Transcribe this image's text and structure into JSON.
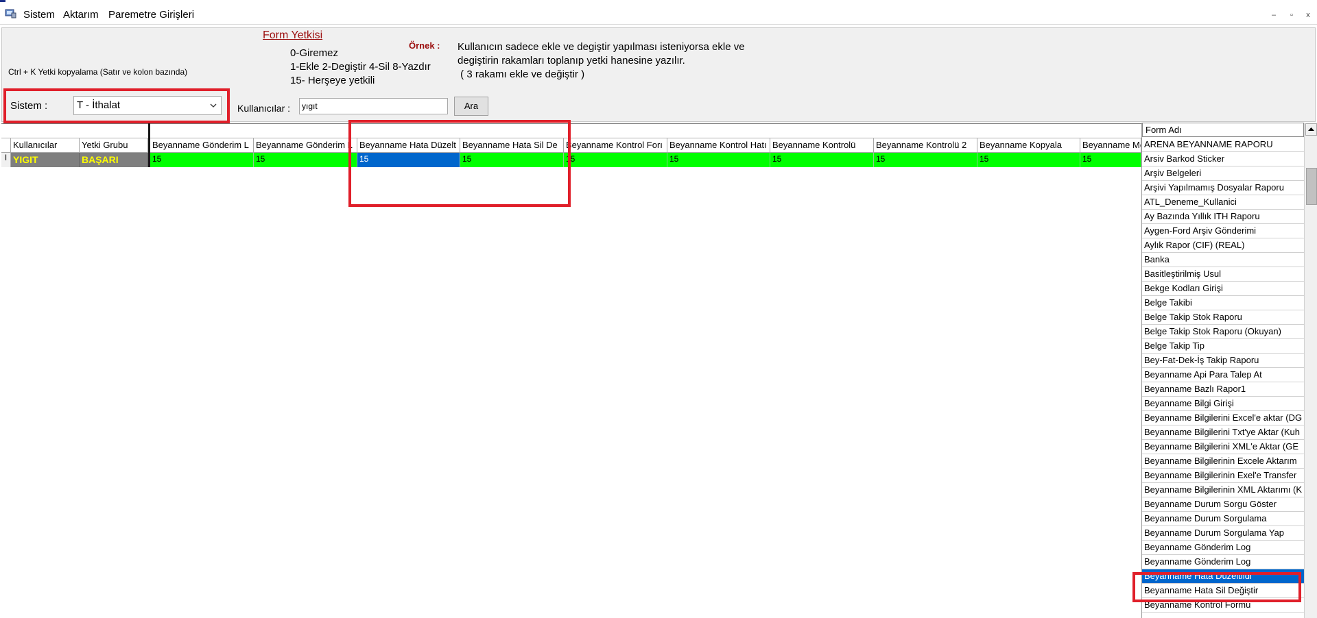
{
  "menu": {
    "items": [
      "Sistem",
      "Aktarım",
      "Paremetre Girişleri"
    ]
  },
  "window_controls": {
    "minimize": "–",
    "restore": "▫",
    "close": "x"
  },
  "panel": {
    "hint": "Ctrl + K Yetki kopyalama (Satır ve kolon bazında)",
    "form_title": "Form Yetkisi",
    "legend": [
      "0-Giremez",
      "1-Ekle  2-Degiştir  4-Sil  8-Yazdır",
      "15- Herşeye yetkili"
    ],
    "example_label": "Örnek :",
    "example_lines": [
      "Kullanıcın sadece ekle ve degiştir yapılması isteniyorsa  ekle ve",
      "degiştirin rakamları toplanıp yetki hanesine yazılır.",
      " ( 3 rakamı ekle ve değiştir )"
    ],
    "sistem_label": "Sistem :",
    "sistem_value": "T - İthalat",
    "users_label": "Kullanıcılar :",
    "users_value": "yıgıt",
    "search_button": "Ara"
  },
  "grid": {
    "fixed_headers": [
      "Kullanıcılar",
      "Yetki Grubu"
    ],
    "headers": [
      "Beyanname Gönderim L",
      "Beyanname Gönderim L",
      "Beyanname Hata Düzelt",
      "Beyanname Hata Sil De",
      "Beyanname Kontrol Forı",
      "Beyanname Kontrol Hatı",
      "Beyanname Kontrolü",
      "Beyanname Kontrolü 2",
      "Beyanname Kopyala",
      "Beyanname Me"
    ],
    "row_indicator": "I",
    "row": {
      "user": "YIGIT",
      "group": "BAŞARI",
      "values": [
        "15",
        "15",
        "15",
        "15",
        "15",
        "15",
        "15",
        "15",
        "15",
        "15"
      ],
      "selected_index": 2
    }
  },
  "form_list": {
    "header": "Form Adı",
    "items": [
      "ARENA BEYANNAME RAPORU",
      "Arsiv Barkod Sticker",
      "Arşiv Belgeleri",
      "Arşivi Yapılmamış Dosyalar Raporu",
      "ATL_Deneme_Kullanici",
      "Ay Bazında Yıllık ITH Raporu",
      "Aygen-Ford Arşiv Gönderimi",
      "Aylık Rapor (CIF) (REAL)",
      "Banka",
      "Basitleştirilmiş Usul",
      "Bekge Kodları Girişi",
      "Belge Takibi",
      "Belge Takip Stok Raporu",
      "Belge Takip Stok Raporu (Okuyan)",
      "Belge Takip Tip",
      "Bey-Fat-Dek-İş Takip Raporu",
      "Beyanname Api Para Talep At",
      "Beyanname Bazlı Rapor1",
      "Beyanname Bilgi Girişi",
      "Beyanname Bilgilerini Excel'e aktar (DG",
      "Beyanname Bilgilerini Txt'ye Aktar (Kuh",
      "Beyanname Bilgilerini XML'e Aktar (GE",
      "Beyanname Bilgilerinin Excele Aktarım",
      "Beyanname Bilgilerinin Exel'e Transfer",
      "Beyanname Bilgilerinin XML Aktarımı (K",
      "Beyanname Durum Sorgu Göster",
      "Beyanname Durum Sorgulama",
      "Beyanname Durum Sorgulama Yap",
      "Beyanname Gönderim Log",
      "Beyanname Gönderim Log",
      "Beyanname Hata Düzeltildi",
      "Beyanname Hata Sil Değiştir",
      "Beyanname Kontrol Formu"
    ],
    "selected_index": 30
  },
  "colors": {
    "highlight_red": "#e01f2a",
    "grid_green": "#00ff00",
    "selection_blue": "#0066cc",
    "fixed_col_gray": "#7f7f7f",
    "fixed_col_text": "#ffff00",
    "title_red": "#9b0e0e"
  }
}
